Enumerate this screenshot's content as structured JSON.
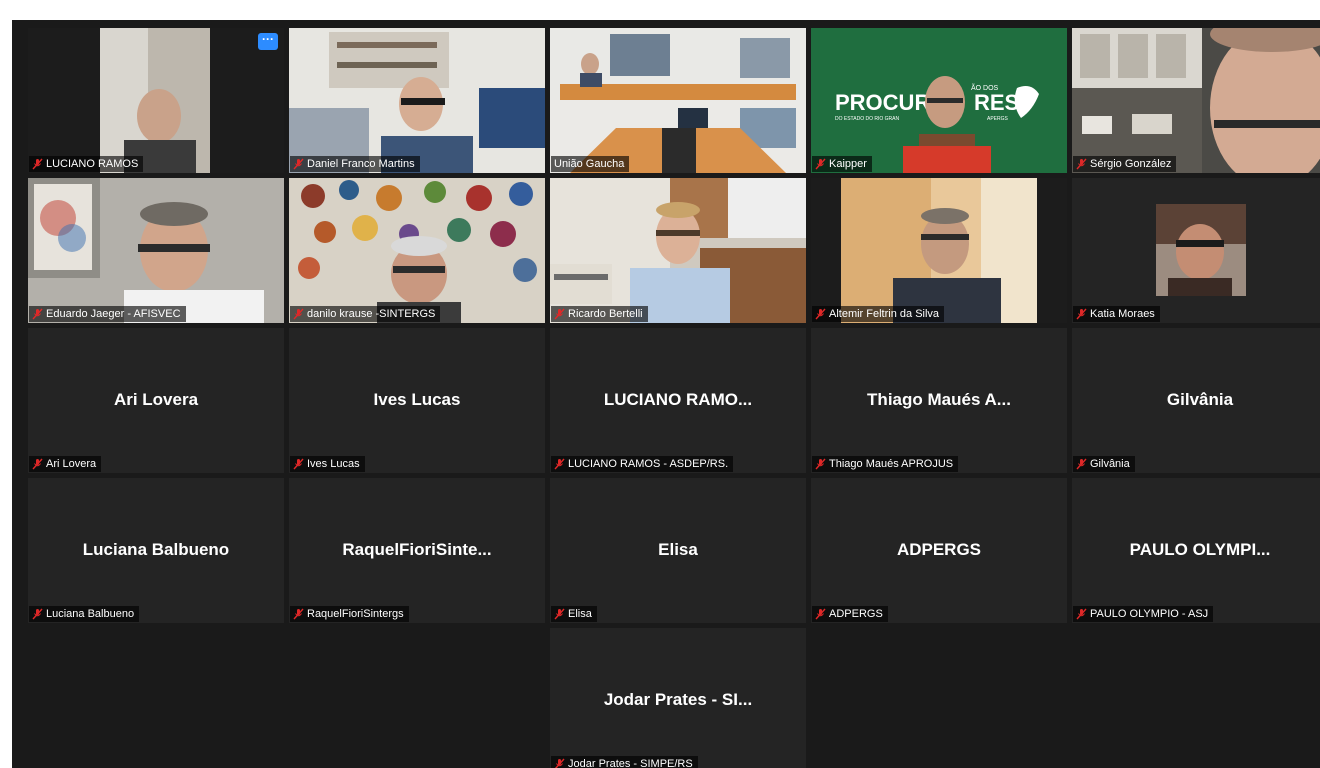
{
  "colors": {
    "background": "#1a1a1a",
    "tile": "#242424",
    "active_speaker": "#9ccc65",
    "mute_red": "#e02828",
    "more_button": "#2d8cff"
  },
  "more_button_label": "···",
  "video_tiles": [
    {
      "label": "LUCIANO RAMOS",
      "scene": "wall-bald"
    },
    {
      "label": "Daniel Franco Martins",
      "scene": "shelves-glasses"
    },
    {
      "label": "União Gaucha",
      "scene": "conference",
      "active": true
    },
    {
      "label": "Kaipper",
      "scene": "banner-red"
    },
    {
      "label": "Sérgio González",
      "scene": "office-closeup"
    },
    {
      "label": "Eduardo Jaeger - AFISVEC",
      "scene": "wall-glasses"
    },
    {
      "label": "danilo krause -SINTERGS",
      "scene": "plates-wall"
    },
    {
      "label": "Ricardo Bertelli",
      "scene": "office-blonde"
    },
    {
      "label": "Altemir Feltrin da Silva",
      "scene": "bright-room"
    },
    {
      "label": "Katia Moraes",
      "scene": "small-video"
    }
  ],
  "banner": {
    "text": "PROCURA",
    "text2": "RES",
    "small_top": "ÃO DOS",
    "sub": "DO ESTADO DO RIO GRAN",
    "sub2": "APERGS"
  },
  "name_tiles": [
    {
      "display": "Ari Lovera",
      "label": "Ari Lovera"
    },
    {
      "display": "Ives Lucas",
      "label": "Ives Lucas"
    },
    {
      "display": "LUCIANO  RAMO...",
      "label": "LUCIANO RAMOS - ASDEP/RS."
    },
    {
      "display": "Thiago Maués A...",
      "label": "Thiago Maués APROJUS"
    },
    {
      "display": "Gilvânia",
      "label": "Gilvânia"
    },
    {
      "display": "Luciana Balbueno",
      "label": "Luciana Balbueno"
    },
    {
      "display": "RaquelFioriSinte...",
      "label": "RaquelFioriSintergs"
    },
    {
      "display": "Elisa",
      "label": "Elisa"
    },
    {
      "display": "ADPERGS",
      "label": "ADPERGS"
    },
    {
      "display": "PAULO  OLYMPI...",
      "label": "PAULO OLYMPIO - ASJ"
    },
    {
      "display": "Jodar Prates - SI...",
      "label": "Jodar Prates - SIMPE/RS"
    }
  ]
}
